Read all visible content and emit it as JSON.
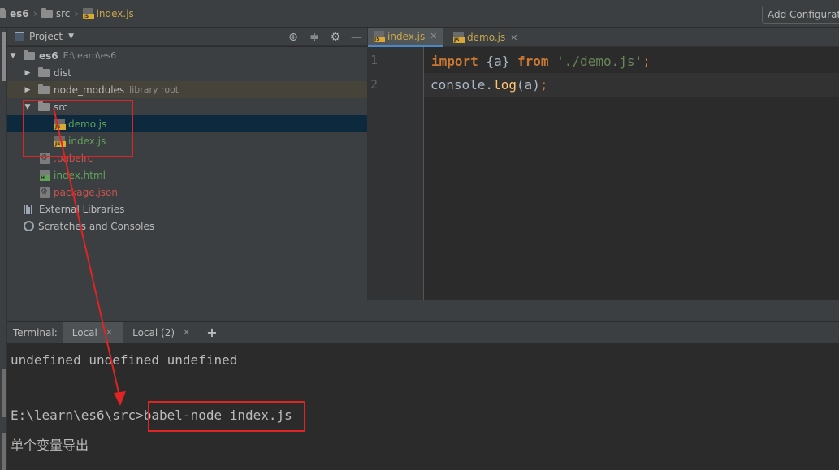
{
  "breadcrumb": {
    "items": [
      "es6",
      "src",
      "index.js"
    ]
  },
  "toolbar": {
    "add_config_label": "Add Configurat"
  },
  "project_panel": {
    "title": "Project",
    "tree": [
      {
        "label": "es6",
        "path": "E:\\learn\\es6"
      },
      {
        "label": "dist"
      },
      {
        "label": "node_modules",
        "note": "library root"
      },
      {
        "label": "src"
      },
      {
        "label": "demo.js"
      },
      {
        "label": "index.js"
      },
      {
        "label": ".babelrc"
      },
      {
        "label": "index.html"
      },
      {
        "label": "package.json"
      },
      {
        "label": "External Libraries"
      },
      {
        "label": "Scratches and Consoles"
      }
    ]
  },
  "editor": {
    "tabs": [
      {
        "label": "index.js",
        "active": true
      },
      {
        "label": "demo.js",
        "active": false
      }
    ],
    "line_numbers": [
      "1",
      "2"
    ],
    "line1": {
      "kw1": "import",
      "brace": "{a}",
      "kw2": "from",
      "str": "'./demo.js'",
      "semi": ";"
    },
    "line2": {
      "obj": "console.",
      "fn": "log",
      "args": "(a)",
      "semi": ";"
    }
  },
  "terminal": {
    "label": "Terminal:",
    "tabs": [
      {
        "label": "Local",
        "active": true
      },
      {
        "label": "Local (2)",
        "active": false
      }
    ],
    "add_symbol": "+",
    "lines": [
      "undefined undefined undefined",
      "E:\\learn\\es6\\src>",
      "babel-node index.js",
      "单个变量导出"
    ]
  },
  "colors": {
    "annotation": "#e02424",
    "keyword": "#cc7832",
    "string": "#6a8759",
    "function": "#ffc66d"
  }
}
